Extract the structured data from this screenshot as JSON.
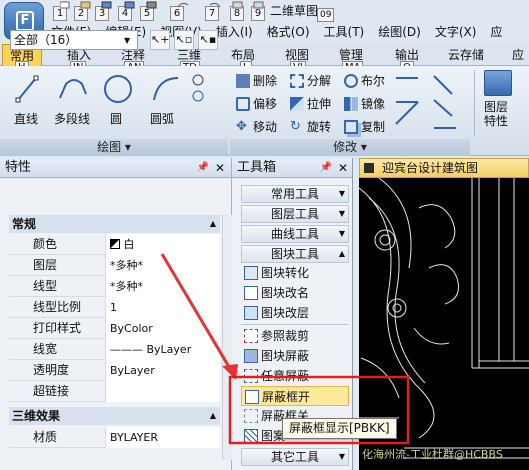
{
  "app": {
    "quick_access_keys": [
      "1",
      "2",
      "3",
      "4",
      "5",
      "6",
      "7",
      "8",
      "9"
    ],
    "document_title": "二维草图",
    "document_title_key": "09"
  },
  "menu": [
    "文件(F)",
    "编辑(E)",
    "视图(V)",
    "插入(I)",
    "格式(O)",
    "工具(T)",
    "绘图(D)",
    "文字(X)",
    "应"
  ],
  "ribbon_tabs": [
    {
      "label": "常用",
      "key": "H",
      "active": true
    },
    {
      "label": "插入",
      "key": "IN"
    },
    {
      "label": "注释",
      "key": "AN"
    },
    {
      "label": "三维",
      "key": "TD"
    },
    {
      "label": "布局",
      "key": "L"
    },
    {
      "label": "视图",
      "key": "VI"
    },
    {
      "label": "管理",
      "key": "MA"
    },
    {
      "label": "输出",
      "key": "O"
    },
    {
      "label": "云存储"
    },
    {
      "label": "应"
    }
  ],
  "ribbon": {
    "draw_tools": [
      "直线",
      "多段线",
      "圆",
      "圆弧"
    ],
    "modify_col1": [
      "删除",
      "偏移",
      "移动"
    ],
    "modify_col2": [
      "分解",
      "拉伸",
      "旋转"
    ],
    "modify_col3": [
      "布尔",
      "镜像",
      "复制"
    ],
    "block_props": "图层\n特性",
    "group_draw": "绘图",
    "group_modify": "修改"
  },
  "properties": {
    "title": "特性",
    "selection": "全部（16）",
    "section_general": "常规",
    "rows_general": [
      {
        "name": "颜色",
        "value": "白"
      },
      {
        "name": "图层",
        "value": "*多种*"
      },
      {
        "name": "线型",
        "value": "*多种*"
      },
      {
        "name": "线型比例",
        "value": "1"
      },
      {
        "name": "打印样式",
        "value": "ByColor"
      },
      {
        "name": "线宽",
        "value": "——— ByLayer"
      },
      {
        "name": "透明度",
        "value": "ByLayer"
      },
      {
        "name": "超链接",
        "value": ""
      }
    ],
    "section_3d": "三维效果",
    "rows_3d": [
      {
        "name": "材质",
        "value": "BYLAYER"
      }
    ]
  },
  "toolbox": {
    "title": "工具箱",
    "categories": [
      "常用工具",
      "图层工具",
      "曲线工具",
      "图块工具"
    ],
    "items": [
      "图块转化",
      "图块改名",
      "图块改层",
      "参照裁剪",
      "图块屏蔽",
      "任意屏蔽",
      "屏蔽框开",
      "屏蔽框关",
      "图案"
    ],
    "bottom_category": "其它工具",
    "tooltip": "屏蔽框显示[PBKK]"
  },
  "drawing": {
    "tab_title": "迎宾台设计建筑图"
  },
  "watermark": "化海州流-工业杜群@HCBBS",
  "colors": {
    "highlight_box": "#e02020",
    "arrow": "#e53333",
    "active_tab": "#ffd35a"
  }
}
